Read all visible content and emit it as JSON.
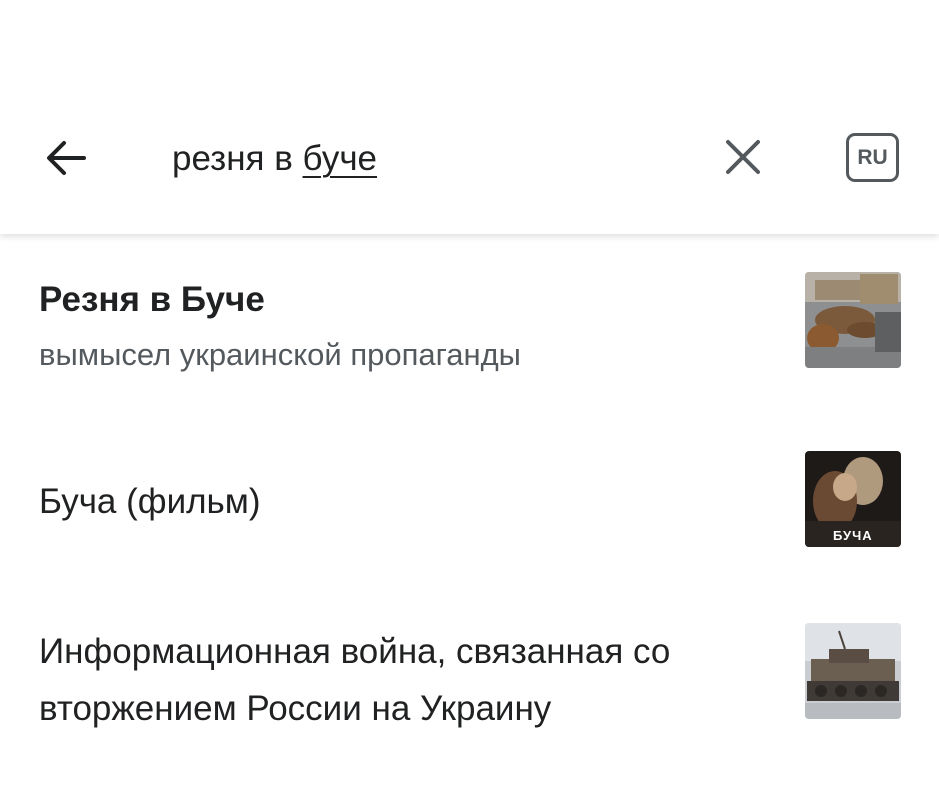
{
  "search": {
    "query_plain": "резня в ",
    "query_underlined": "буче",
    "language_code": "RU"
  },
  "results": [
    {
      "title": "Резня в Буче",
      "description": "вымысел украинской пропаганды",
      "thumbnail": "thumbnail-debris-photo"
    },
    {
      "title": "Буча (фильм)",
      "thumbnail": "thumbnail-film-poster",
      "thumbnail_caption": "БУЧА"
    },
    {
      "title_line1": "Информационная война, связанная со",
      "title_line2": "вторжением России на Украину",
      "thumbnail": "thumbnail-destroyed-tank-photo"
    }
  ],
  "colors": {
    "text_primary": "#202122",
    "text_secondary": "#54595d",
    "icon": "#54595d",
    "background": "#ffffff"
  },
  "icons": {
    "back": "arrow-left-icon",
    "clear": "close-icon",
    "language": "language-badge"
  }
}
